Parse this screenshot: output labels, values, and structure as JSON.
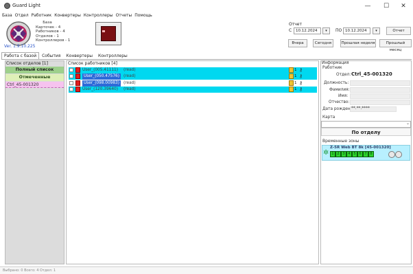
{
  "window": {
    "title": "Guard Light",
    "minimize": "—",
    "maximize": "☐",
    "close": "✕"
  },
  "menu": [
    "База",
    "Отдел",
    "Работник",
    "Конвертеры",
    "Контроллеры",
    "Отчеты",
    "Помощь"
  ],
  "db_info": {
    "heading": "База",
    "cards": "Карточек - 4",
    "workers": "Работников - 4",
    "departments": "Отделов - 1",
    "controllers": "Контроллеров - 1"
  },
  "version": "Ver. 1.9.10.225",
  "report": {
    "label": "Отчет",
    "from_label": "С",
    "from_date": "10.12.2024",
    "to_label": "ПО",
    "to_date": "10.12.2024",
    "report_button": "Отчет",
    "yesterday": "Вчера",
    "today": "Сегодня",
    "last_week": "Прошлая неделя",
    "last_month": "Прошлый месяц"
  },
  "tabs": [
    "Работа с базой",
    "События",
    "Конвертеры",
    "Контроллеры"
  ],
  "departments_panel": {
    "title": "Список отделов [1]",
    "full_list": "Полный список",
    "marked": "Отмеченные",
    "items": [
      "Ctrl_45-001320"
    ]
  },
  "workers_panel": {
    "title": "Список работников [4]",
    "rows": [
      {
        "name": "User_(005.41111)",
        "access": "(read)",
        "num": "1"
      },
      {
        "name": "User_(050.47576)",
        "access": "(read)",
        "num": "1"
      },
      {
        "name": "User_(098.00983)",
        "access": "(read)",
        "num": "1"
      },
      {
        "name": "User_(120.39640)",
        "access": "(read)",
        "num": "1"
      }
    ]
  },
  "info_panel": {
    "title": "Информация",
    "worker": "Работник",
    "dept_label": "Отдел:",
    "dept_value": "Ctrl_45-001320",
    "position": "Должность:",
    "lastname": "Фамилия:",
    "firstname": "Имя:",
    "patronymic": "Отчество:",
    "birthdate_label": "Дата рождения:",
    "birthdate_value": "**.**.****",
    "card": "Карта",
    "by_department": "По отделу",
    "time_zones": "Временные зоны",
    "zone_name": "Z-5R Web BT 8k [45-001320]",
    "zone_cells": [
      "1",
      "2",
      "3",
      "4",
      "5",
      "6",
      "7",
      "8"
    ]
  },
  "status": {
    "text": "Выбрано: 0    Всего: 4    Отдел: 1"
  },
  "colors": {
    "accent_cyan": "#00d8f0",
    "full_list_green": "#9ed08c",
    "marked_green": "#dff0b8",
    "dept_pink": "#f6c3ef",
    "time_zone_green": "#2bd12b"
  }
}
